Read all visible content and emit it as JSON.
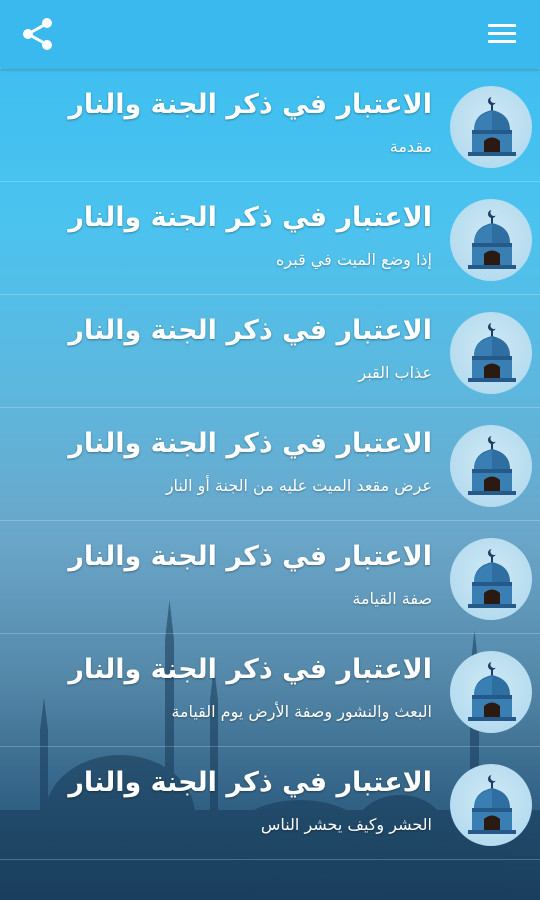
{
  "toolbar": {
    "share_icon": "share-icon",
    "menu_icon": "hamburger-menu-icon",
    "color": "#3ab9ee"
  },
  "items": [
    {
      "title": "الاعتبار في ذكر الجنة والنار",
      "subtitle": "مقدمة",
      "icon": "mosque-icon"
    },
    {
      "title": "الاعتبار في ذكر الجنة والنار",
      "subtitle": "إذا وضع الميت في قبره",
      "icon": "mosque-icon"
    },
    {
      "title": "الاعتبار في ذكر الجنة والنار",
      "subtitle": "عذاب القبر",
      "icon": "mosque-icon"
    },
    {
      "title": "الاعتبار في ذكر الجنة والنار",
      "subtitle": "عرض مقعد الميت عليه من الجنة أو النار",
      "icon": "mosque-icon"
    },
    {
      "title": "الاعتبار في ذكر الجنة والنار",
      "subtitle": "صفة القيامة",
      "icon": "mosque-icon"
    },
    {
      "title": "الاعتبار في ذكر الجنة والنار",
      "subtitle": "البعث والنشور وصفة الأرض يوم القيامة",
      "icon": "mosque-icon"
    },
    {
      "title": "الاعتبار في ذكر الجنة والنار",
      "subtitle": "الحشر وكيف يحشر الناس",
      "icon": "mosque-icon"
    }
  ]
}
